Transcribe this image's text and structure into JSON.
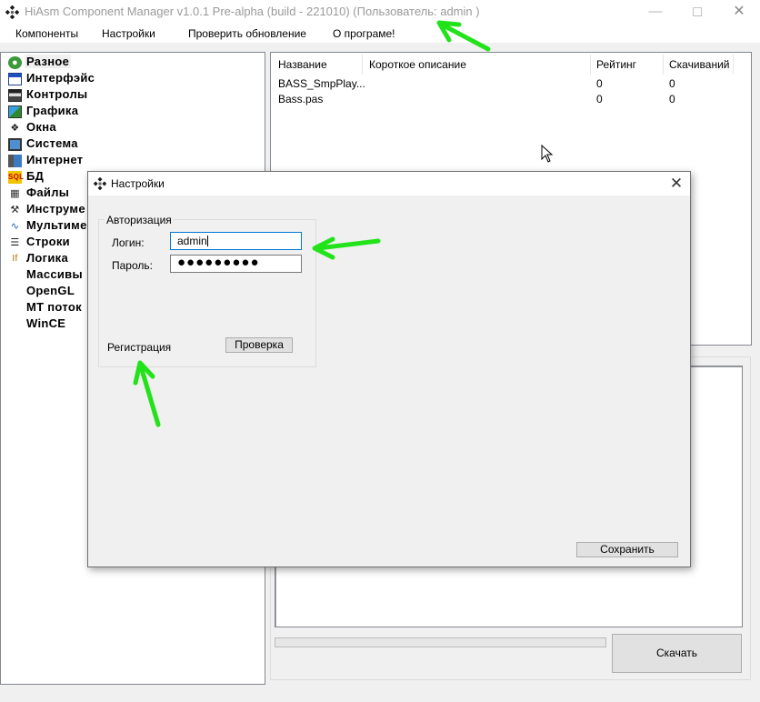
{
  "window": {
    "title": "HiAsm Component Manager v1.0.1 Pre-alpha (build - 221010) (Пользователь: admin )",
    "min_icon": "minimize-icon",
    "max_icon": "maximize-icon",
    "close_icon": "close-icon"
  },
  "menu": {
    "items": [
      "Компоненты",
      "Настройки",
      "Проверить обновление",
      "О програме!"
    ]
  },
  "tree": {
    "items": [
      {
        "label": "Разное",
        "icon": "globe-icon",
        "selected": true
      },
      {
        "label": "Интерфэйс",
        "icon": "window-icon"
      },
      {
        "label": "Контролы",
        "icon": "controls-icon"
      },
      {
        "label": "Графика",
        "icon": "image-icon"
      },
      {
        "label": "Окна",
        "icon": "dialog-icon"
      },
      {
        "label": "Система",
        "icon": "monitor-icon"
      },
      {
        "label": "Интернет",
        "icon": "network-icon"
      },
      {
        "label": "БД",
        "icon": "database-icon"
      },
      {
        "label": "Файлы",
        "icon": "files-icon"
      },
      {
        "label": "Инструме",
        "icon": "tools-icon"
      },
      {
        "label": "Мультиме",
        "icon": "sound-icon"
      },
      {
        "label": "Строки",
        "icon": "strings-icon"
      },
      {
        "label": "Логика",
        "icon": "logic-icon"
      },
      {
        "label": "Массивы",
        "icon": ""
      },
      {
        "label": "OpenGL",
        "icon": ""
      },
      {
        "label": "MT поток",
        "icon": ""
      },
      {
        "label": "WinCE",
        "icon": ""
      }
    ]
  },
  "list": {
    "columns": [
      "Название",
      "Короткое описание",
      "Рейтинг",
      "Скачиваний"
    ],
    "rows": [
      {
        "name": "BASS_SmpPlay...",
        "desc": "",
        "rating": "0",
        "downloads": "0"
      },
      {
        "name": "Bass.pas",
        "desc": "",
        "rating": "0",
        "downloads": "0"
      }
    ]
  },
  "download": {
    "button_label": "Скачать",
    "progress": 0
  },
  "dialog": {
    "title": "Настройки",
    "group_label": "Авторизация",
    "login_label": "Логин:",
    "login_value": "admin",
    "password_label": "Пароль:",
    "password_value": "●●●●●●●●●",
    "register_label": "Регистрация",
    "check_button": "Проверка",
    "save_button": "Сохранить"
  },
  "colors": {
    "accent": "#0078d7",
    "annotation": "#22e31a",
    "progress_fill": "#06b025"
  }
}
